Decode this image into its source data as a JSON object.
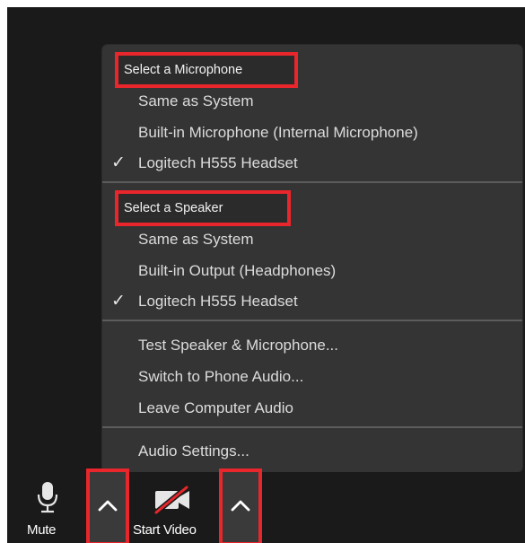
{
  "menu": {
    "microphone_header": "Select a Microphone",
    "microphone_options": [
      {
        "label": "Same as System",
        "checked": false
      },
      {
        "label": "Built-in Microphone (Internal Microphone)",
        "checked": false
      },
      {
        "label": "Logitech H555 Headset",
        "checked": true
      }
    ],
    "speaker_header": "Select a Speaker",
    "speaker_options": [
      {
        "label": "Same as System",
        "checked": false
      },
      {
        "label": "Built-in Output (Headphones)",
        "checked": false
      },
      {
        "label": "Logitech H555 Headset",
        "checked": true
      }
    ],
    "actions": [
      "Test Speaker & Microphone...",
      "Switch to Phone Audio...",
      "Leave Computer Audio"
    ],
    "settings": "Audio Settings...",
    "check_glyph": "✓"
  },
  "toolbar": {
    "mute_label": "Mute",
    "start_video_label": "Start Video"
  },
  "colors": {
    "highlight": "#e8262b",
    "menu_bg": "#343434",
    "window_bg": "#1a1a1a",
    "video_off_slash": "#e8262b"
  },
  "icons": [
    "microphone-icon",
    "caret-up-icon",
    "video-off-icon"
  ]
}
